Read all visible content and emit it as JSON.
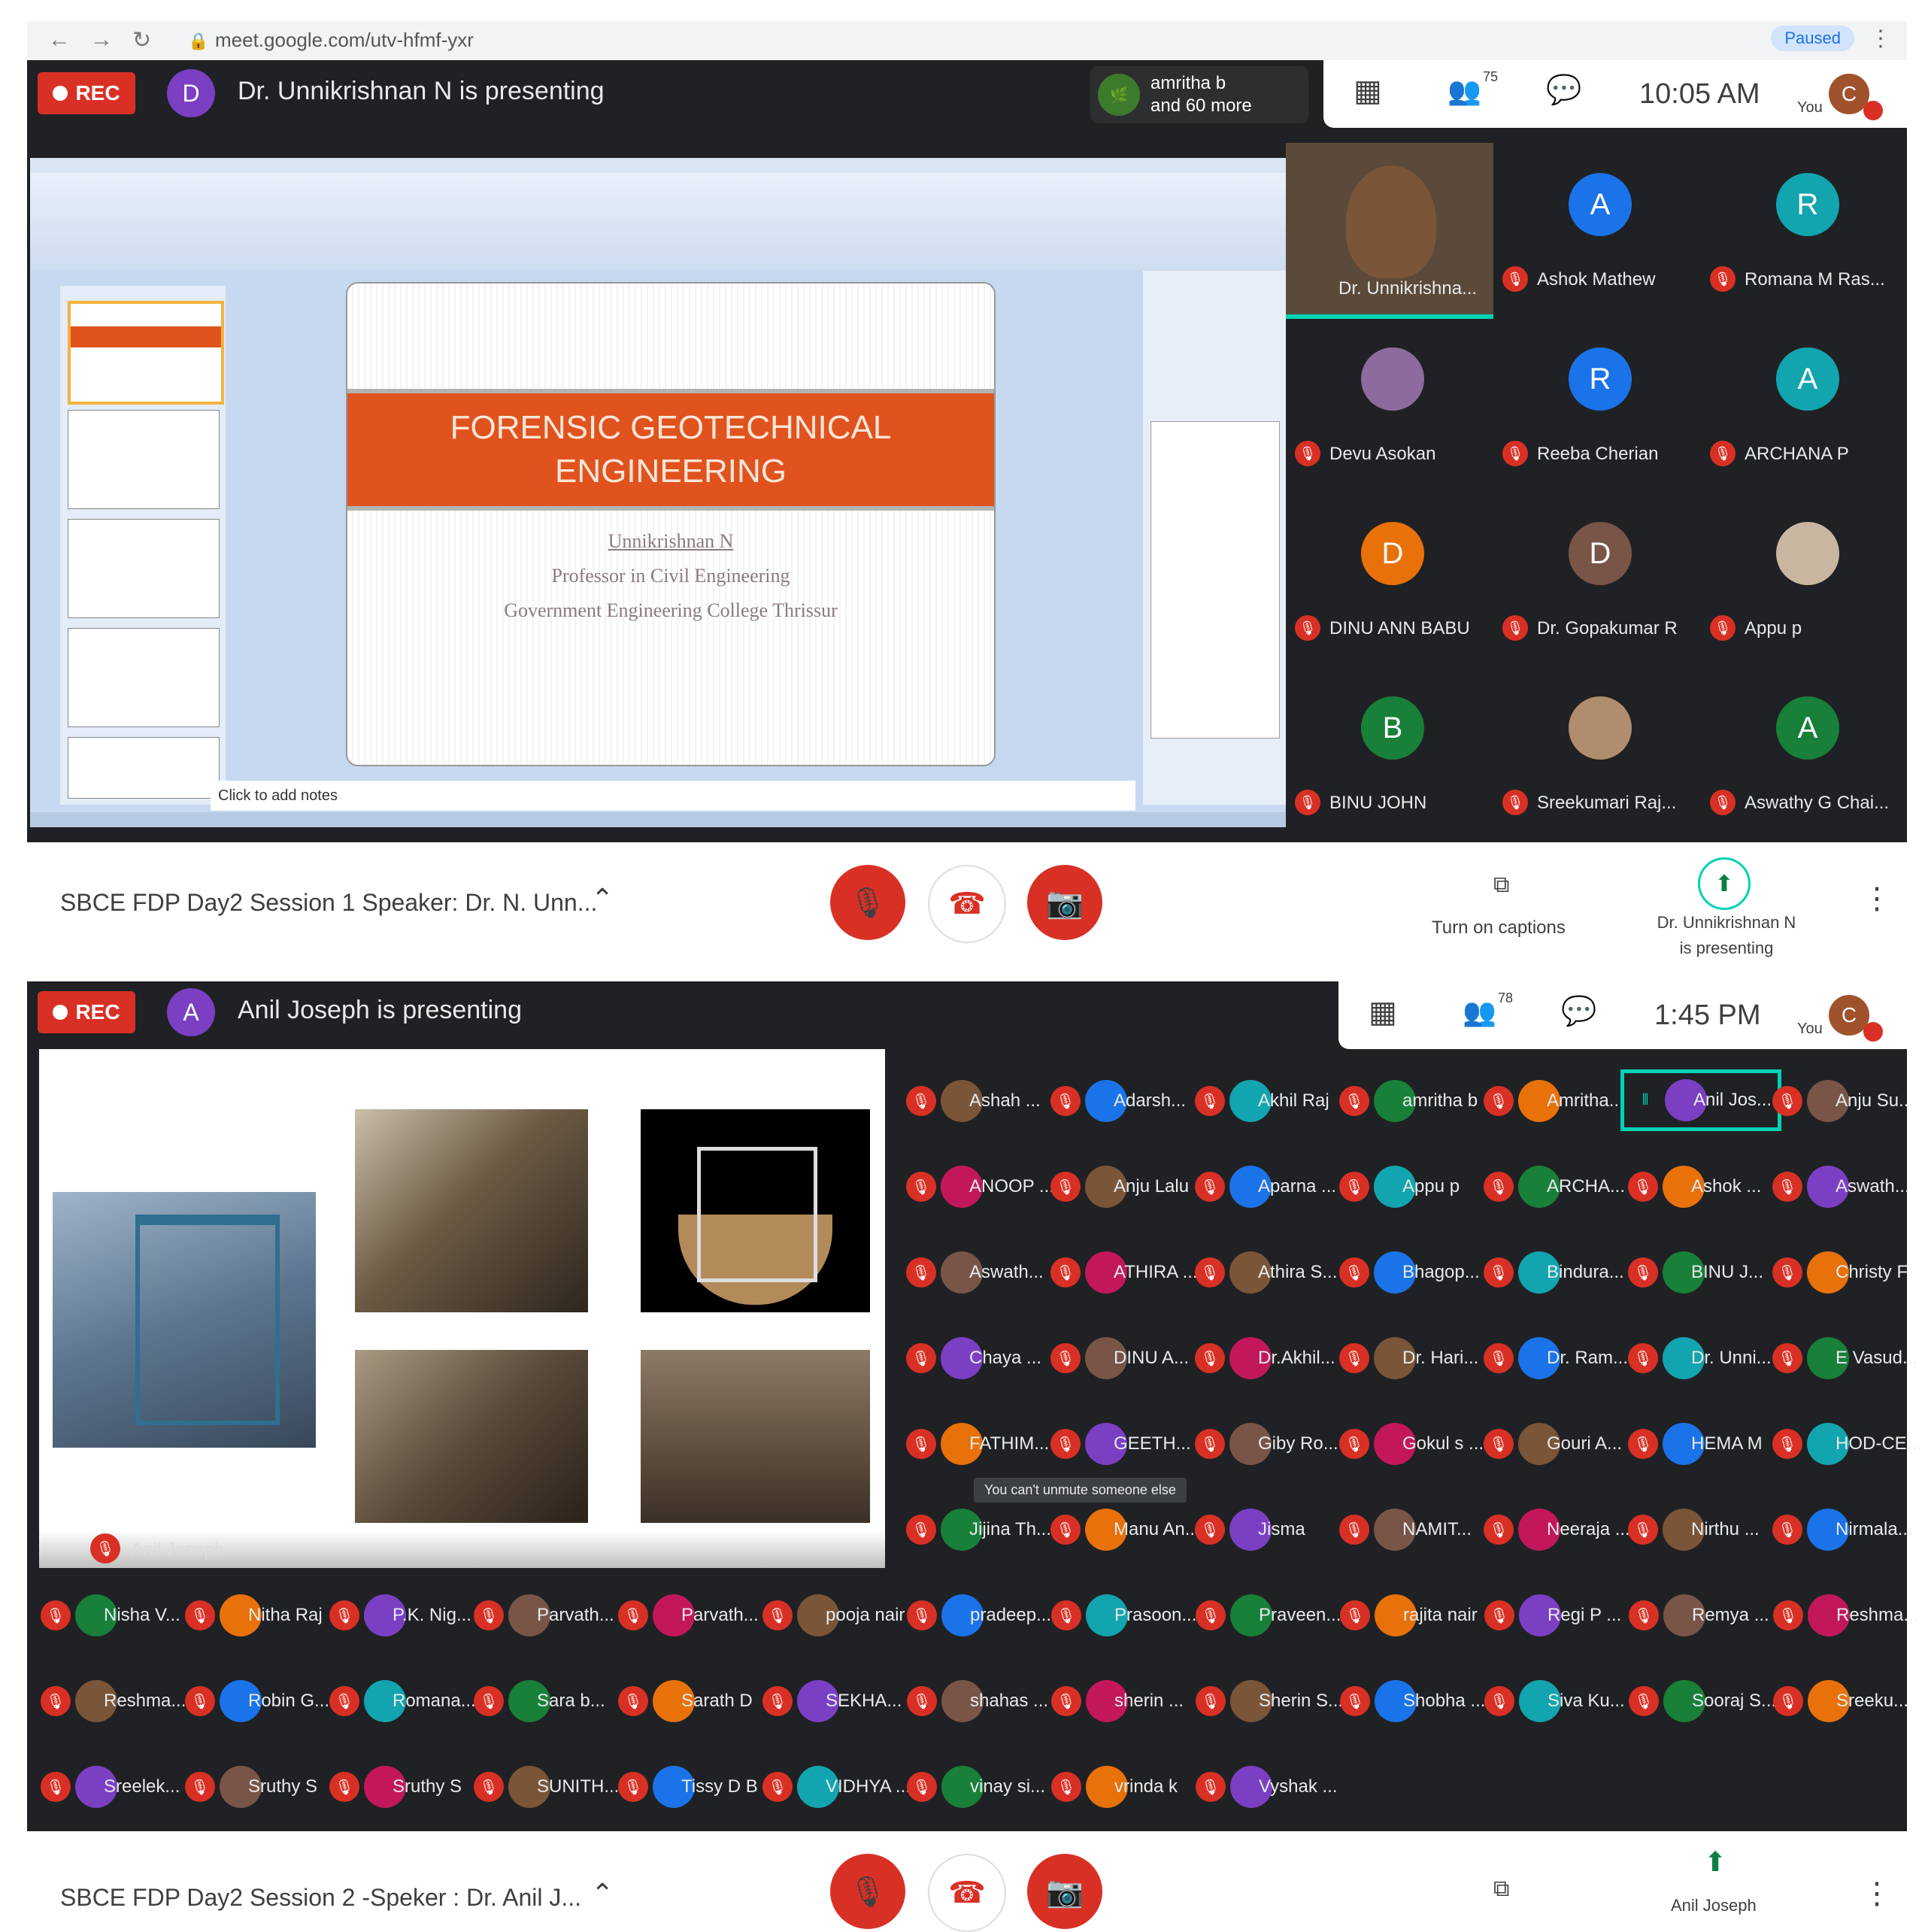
{
  "browser": {
    "url": "meet.google.com/utv-hfmf-yxr",
    "profile_badge": "Paused"
  },
  "session1": {
    "rec_label": "REC",
    "presenter_initial": "D",
    "presenter_text": "Dr. Unnikrishnan N is presenting",
    "joiners_text_1": "amritha b",
    "joiners_text_2": "and 60 more",
    "participants_count": "75",
    "time": "10:05 AM",
    "you_label": "You",
    "you_initial": "C",
    "slide": {
      "title_line1": "FORENSIC GEOTECHNICAL",
      "title_line2": "ENGINEERING",
      "author": "Unnikrishnan N",
      "position": "Professor in Civil Engineering",
      "college": "Government Engineering College Thrissur",
      "notes_placeholder": "Click to add notes"
    },
    "tiles": [
      {
        "name": "Dr. Unnikrishna...",
        "initial": "",
        "color": "#6b5a3a"
      },
      {
        "name": "Ashok Mathew",
        "initial": "A",
        "color": "#1a73e8"
      },
      {
        "name": "Romana M Ras...",
        "initial": "R",
        "color": "#12a4af"
      },
      {
        "name": "Devu Asokan",
        "initial": "",
        "color": "#8e6b9e"
      },
      {
        "name": "Reeba Cherian",
        "initial": "R",
        "color": "#1a73e8"
      },
      {
        "name": "ARCHANA P",
        "initial": "A",
        "color": "#12a4af"
      },
      {
        "name": "DINU ANN BABU",
        "initial": "D",
        "color": "#e8710a"
      },
      {
        "name": "Dr. Gopakumar R",
        "initial": "D",
        "color": "#795548"
      },
      {
        "name": "Appu p",
        "initial": "",
        "color": "#c9b6a0"
      },
      {
        "name": "BINU JOHN",
        "initial": "B",
        "color": "#188038"
      },
      {
        "name": "Sreekumari Raj...",
        "initial": "",
        "color": "#b08d6e"
      },
      {
        "name": "Aswathy G Chai...",
        "initial": "A",
        "color": "#188038"
      }
    ],
    "meeting_title": "SBCE FDP Day2 Session 1 Speaker: Dr. N. Unn...",
    "captions_label": "Turn on captions",
    "present_label_1": "Dr. Unnikrishnan N",
    "present_label_2": "is presenting"
  },
  "session2": {
    "rec_label": "REC",
    "presenter_initial": "A",
    "presenter_text": "Anil Joseph is presenting",
    "participants_count": "78",
    "time": "1:45 PM",
    "you_label": "You",
    "you_initial": "C",
    "presenter_tile_name": "Anil Joseph",
    "tooltip": "You can't unmute someone else",
    "grid_right": [
      [
        "Ashah ...",
        "Adarsh...",
        "Akhil Raj",
        "amritha b",
        "Amritha...",
        "Anil Jos...",
        "Anju Su..."
      ],
      [
        "ANOOP ...",
        "Anju Lalu",
        "Aparna ...",
        "Appu p",
        "ARCHA...",
        "Ashok ...",
        "Aswath..."
      ],
      [
        "Aswath...",
        "ATHIRA ...",
        "Athira S...",
        "Bhagop...",
        "Bindura...",
        "BINU J...",
        "Christy F"
      ],
      [
        "Chaya ...",
        "DINU A...",
        "Dr.Akhil...",
        "Dr. Hari...",
        "Dr. Ram...",
        "Dr. Unni...",
        "E Vasud..."
      ],
      [
        "FATHIM...",
        "GEETH...",
        "Giby Ro...",
        "Gokul s ...",
        "Gouri A...",
        "HEMA M",
        "HOD-CE..."
      ],
      [
        "Jijina Th...",
        "Manu An...",
        "Jisma",
        "NAMIT...",
        "Neeraja ...",
        "Nirthu ...",
        "Nirmala..."
      ]
    ],
    "grid_bottom": [
      [
        "Nisha V...",
        "Nitha Raj",
        "P.K. Nig...",
        "Parvath...",
        "Parvath...",
        "pooja nair",
        "pradeep...",
        "Prasoon...",
        "Praveen...",
        "rajita nair",
        "Regi P ...",
        "Remya ...",
        "Reshma..."
      ],
      [
        "Reshma...",
        "Robin G...",
        "Romana...",
        "Sara b...",
        "Sarath D",
        "SEKHA...",
        "shahas ...",
        "sherin ...",
        "Sherin S...",
        "Shobha ...",
        "Siva Ku...",
        "Sooraj S...",
        "Sreeku..."
      ],
      [
        "Sreelek...",
        "Sruthy S",
        "Sruthy S",
        "SUNITH...",
        "Tissy D B",
        "VIDHYA ...",
        "vinay si...",
        "vrinda k",
        "Vyshak ..."
      ]
    ],
    "meeting_title": "SBCE FDP Day2 Session 2 -Speker : Dr. Anil J...",
    "present_label": "Anil Joseph"
  },
  "colors": {
    "red": "#d93025",
    "dark": "#202124",
    "teal": "#00d2b4",
    "orange": "#e0531e"
  }
}
